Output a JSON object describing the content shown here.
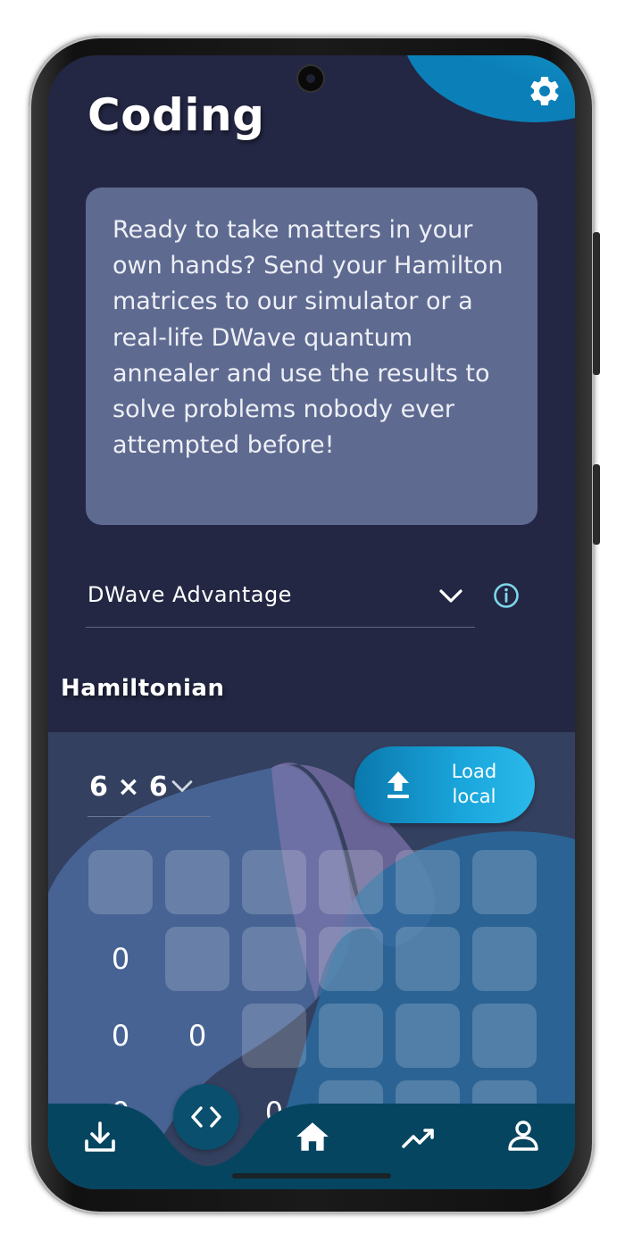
{
  "header": {
    "title": "Coding"
  },
  "info_card": {
    "text": "Ready to take matters in your own hands? Send your Hamilton matrices to our simulator or a real-life DWave quantum annealer and use the results to solve problems nobody ever attempted before!"
  },
  "device_select": {
    "value": "DWave Advantage"
  },
  "hamiltonian": {
    "section_title": "Hamiltonian",
    "size_value": "6 × 6",
    "load_button_label": "Load local",
    "row1": [
      "0"
    ],
    "row2": [
      "0",
      "0"
    ],
    "row3": [
      "0",
      "0"
    ]
  },
  "colors": {
    "background": "#232744",
    "accent": "#1aa6dc",
    "card": "#5e6a90",
    "nav": "#064560",
    "info_icon": "#7fd6ea"
  },
  "icons": {
    "settings": "gear-icon",
    "device_dropdown": "chevron-down-icon",
    "device_info": "info-icon",
    "size_dropdown": "chevron-down-icon",
    "load": "upload-icon",
    "nav": [
      "download-icon",
      "code-icon",
      "home-icon",
      "chart-line-icon",
      "user-icon"
    ]
  }
}
